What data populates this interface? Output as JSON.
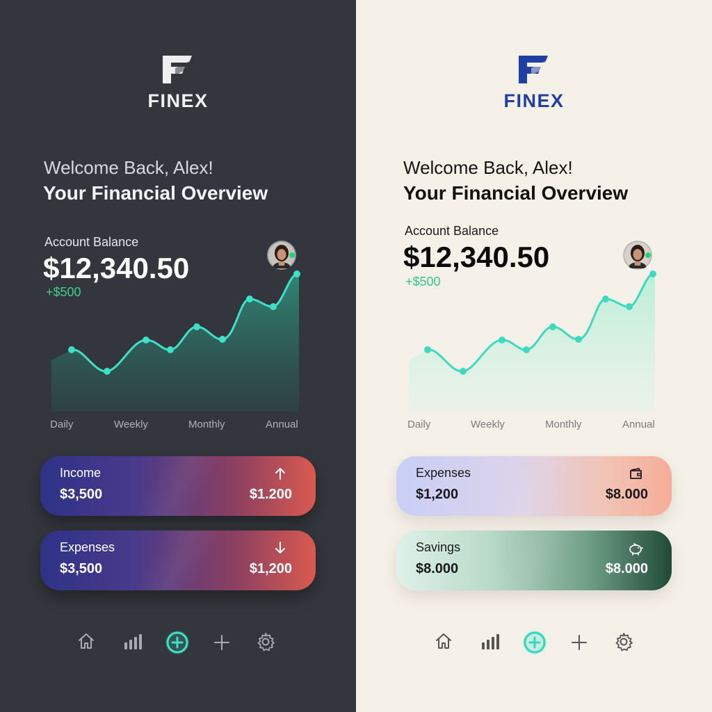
{
  "panels": [
    {
      "theme": "dark",
      "logo_text": "FINEX",
      "welcome": "Welcome Back, Alex!",
      "overview": "Your Financial Overview",
      "balance_label": "Account Balance",
      "balance_value": "$12,340.50",
      "balance_delta": "+$500",
      "periods": [
        "Daily",
        "Weekly",
        "Monthly",
        "Annual"
      ],
      "cards": [
        {
          "title": "Income",
          "left_value": "$3,500",
          "right_value": "$1.200",
          "icon": "arrow-up-icon"
        },
        {
          "title": "Expenses",
          "left_value": "$3,500",
          "right_value": "$1,200",
          "icon": "arrow-down-icon"
        }
      ],
      "nav": [
        "home-icon",
        "bar-chart-icon",
        "add-circle-icon",
        "plus-icon",
        "gear-icon"
      ]
    },
    {
      "theme": "light",
      "logo_text": "FINEX",
      "welcome": "Welcome Back, Alex!",
      "overview": "Your Financial Overview",
      "balance_label": "Account Balance",
      "balance_value": "$12,340.50",
      "balance_delta": "+$500",
      "periods": [
        "Daily",
        "Weekly",
        "Monthly",
        "Annual"
      ],
      "cards": [
        {
          "title": "Expenses",
          "left_value": "$1,200",
          "right_value": "$8.000",
          "icon": "wallet-icon"
        },
        {
          "title": "Savings",
          "left_value": "$8.000",
          "right_value": "$8.000",
          "icon": "piggy-bank-icon"
        }
      ],
      "nav": [
        "home-icon",
        "bar-chart-icon",
        "add-circle-icon",
        "plus-icon",
        "gear-icon"
      ]
    }
  ],
  "colors": {
    "dark_bg": "#33363c",
    "light_bg": "#f6f1e8",
    "accent": "#3de0c8",
    "positive": "#3fcf8e",
    "brand_dark": "#f1f1f1",
    "brand_light": "#1f3fa3"
  }
}
